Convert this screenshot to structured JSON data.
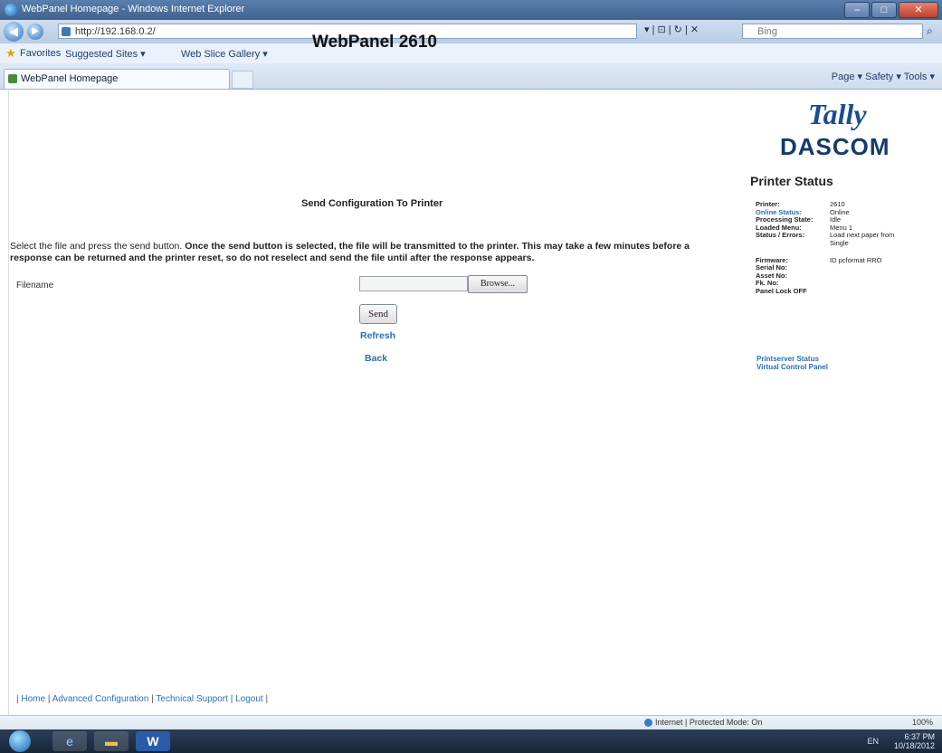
{
  "browser": {
    "window_title": "WebPanel Homepage - Windows Internet Explorer",
    "address": "http://192.168.0.2/",
    "search_placeholder": "Bing",
    "favorites_label": "Favorites",
    "suggested_sites": "Suggested Sites ▾",
    "web_slice_gallery": "Web Slice Gallery ▾",
    "tab_title": "WebPanel Homepage",
    "command_bar": "Page ▾  Safety ▾  Tools ▾",
    "status_zone": "Internet | Protected Mode: On",
    "zoom": "100%"
  },
  "page": {
    "title": "WebPanel 2610",
    "logo_top": "Tally",
    "logo_bottom": "DASCOM",
    "section_title": "Send Configuration To Printer",
    "instruction_plain": "Select the file and press the send button. ",
    "instruction_bold": "Once the send button is selected, the file will be transmitted to the printer. This may take a few minutes before a response can be returned and the printer reset, so do not reselect and send the file until after the response appears.",
    "filename_label": "Filename",
    "browse_label": "Browse...",
    "send_label": "Send",
    "refresh_label": "Refresh",
    "back_label": "Back"
  },
  "printer_status": {
    "heading": "Printer Status",
    "rows": [
      {
        "key": "Printer:",
        "value": "2610"
      },
      {
        "key": "Online Status:",
        "value": "Online"
      },
      {
        "key": "Processing State:",
        "value": "Idle"
      },
      {
        "key": "Loaded Menu:",
        "value": "Menu 1"
      },
      {
        "key": "Status / Errors:",
        "value": "Load next paper from Single"
      }
    ],
    "rows2": [
      {
        "key": "Firmware:",
        "value": "ID pcformat RRO"
      },
      {
        "key": "Serial No:",
        "value": ""
      },
      {
        "key": "Asset No:",
        "value": ""
      },
      {
        "key": "Fk. No:",
        "value": ""
      },
      {
        "key": "Panel Lock OFF",
        "value": ""
      }
    ],
    "link_printserver": "Printserver Status",
    "link_virtual_panel": "Virtual Control Panel"
  },
  "footer": {
    "home": "Home",
    "advanced": "Advanced Configuration",
    "support": "Technical Support",
    "logout": "Logout"
  },
  "taskbar": {
    "time": "6:37 PM",
    "date": "10/18/2012",
    "lang": "EN"
  }
}
